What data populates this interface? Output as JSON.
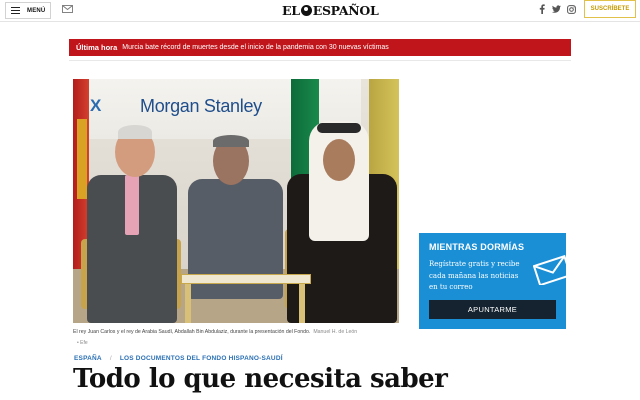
{
  "header": {
    "menu_label": "MENÚ",
    "logo_left": "EL",
    "logo_right": "ESPAÑOL",
    "subscribe_label": "SUSCRÍBETE",
    "social_icons": [
      "facebook-icon",
      "twitter-icon",
      "instagram-icon"
    ]
  },
  "breaking": {
    "label": "Última hora",
    "text": "Murcia bate récord de muertes desde el inicio de la pandemia con 30 nuevas víctimas"
  },
  "photo": {
    "sign_text": "Morgan Stanley",
    "sign_mark": "X",
    "caption": "El rey Juan Carlos y el rey de Arabia Saudí, Abdallah Bin Abdulaziz, durante la presentación del Fondo.",
    "credit": "Manuel H. de León",
    "source": "Efe"
  },
  "article": {
    "section": "ESPAÑA",
    "subsection": "LOS DOCUMENTOS DEL FONDO HISPANO-SAUDÍ",
    "headline": "Todo lo que necesita saber"
  },
  "newsletter": {
    "title": "MIENTRAS DORMÍAS",
    "text": "Regístrate gratis y recibe cada mañana las noticias en tu correo",
    "button_label": "APUNTARME"
  },
  "colors": {
    "breaking_bg": "#c0151b",
    "newsletter_bg": "#1a8fd6",
    "newsletter_button": "#14232f",
    "section_link": "#2a6fb5",
    "subscribe_gold": "#c59b00"
  }
}
